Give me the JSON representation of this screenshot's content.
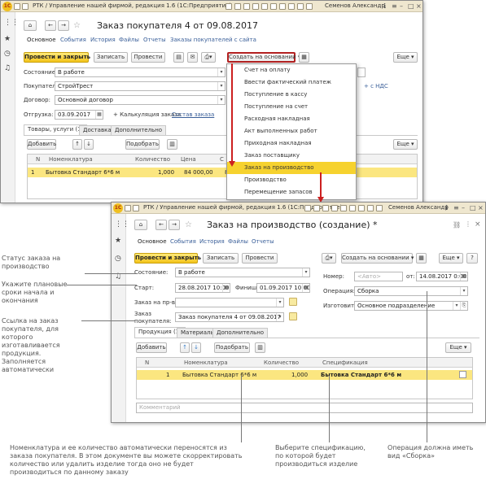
{
  "win1": {
    "title_bar": "РТК / Управление нашей фирмой, редакция 1.6  (1С:Предприятие)",
    "user": "Семенов Александр",
    "doc_title": "Заказ покупателя 4  от 09.08.2017",
    "nav_tabs": [
      "Основное",
      "События",
      "История",
      "Файлы",
      "Отчеты",
      "Заказы покупателей с сайта"
    ],
    "toolbar": {
      "post_close": "Провести и закрыть",
      "save": "Записать",
      "post": "Провести",
      "create_based": "Создать на основании",
      "more": "Еще"
    },
    "fields": {
      "state_label": "Состояние:",
      "state_value": "В работе",
      "buyer_label": "Покупатель:",
      "buyer_value": "СтройТрест",
      "contract_label": "Договор:",
      "contract_value": "Основной договор",
      "ship_label": "Отгрузка:",
      "ship_value": "03.09.2017",
      "calc_link": "+ Калькуляция заказа",
      "order_composition": "Состав заказа",
      "vat_link": "+ с НДС"
    },
    "tabs": [
      "Товары, услуги (1)",
      "Доставка",
      "Дополнительно"
    ],
    "table_toolbar": {
      "add": "Добавить",
      "pick": "Подобрать",
      "more": "Еще"
    },
    "columns": [
      "N",
      "Номенклатура",
      "Количество",
      "Цена",
      "С"
    ],
    "rows": [
      {
        "n": "1",
        "item": "Бытовка Стандарт 6*6 м",
        "qty": "1,000",
        "price": "84 000,00",
        "sum": "8"
      }
    ],
    "menu": [
      "Счет на оплату",
      "Ввести фактический платеж",
      "Поступление в кассу",
      "Поступление на счет",
      "Расходная накладная",
      "Акт выполненных работ",
      "Приходная накладная",
      "Заказ поставщику",
      "Заказ на производство",
      "Производство",
      "Перемещение запасов"
    ],
    "menu_selected": "Заказ на производство"
  },
  "win2": {
    "title_bar": "РТК / Управление нашей фирмой, редакция 1.6  (1С:Предприятие)",
    "user": "Семенов Александр",
    "doc_title": "Заказ на производство (создание) *",
    "nav_tabs": [
      "Основное",
      "События",
      "История",
      "Файлы",
      "Отчеты"
    ],
    "toolbar": {
      "post_close": "Провести и закрыть",
      "save": "Записать",
      "post": "Провести",
      "create_based": "Создать на основании",
      "more": "Еще",
      "help": "?"
    },
    "fields": {
      "state_label": "Состояние:",
      "state_value": "В работе",
      "start_label": "Старт:",
      "start_value": "28.08.2017 10:00",
      "finish_label": "Финиш:",
      "finish_value": "01.09.2017 10:00",
      "pp_label": "Заказ на пр-во:",
      "buyer_order_label": "Заказ покупателя:",
      "buyer_order_value": "Заказ покупателя 4  от 09.08.2017",
      "number_label": "Номер:",
      "number_placeholder": "<Авто>",
      "from_label": "от:",
      "from_value": "14.08.2017  0:00:00",
      "op_label": "Операция:",
      "op_value": "Сборка",
      "maker_label": "Изготовитель:",
      "maker_value": "Основное подразделение"
    },
    "tabs": [
      "Продукция (1)",
      "Материалы",
      "Дополнительно"
    ],
    "table_toolbar": {
      "add": "Добавить",
      "pick": "Подобрать",
      "more": "Еще"
    },
    "columns": [
      "N",
      "Номенклатура",
      "Количество",
      "Спецификация"
    ],
    "rows": [
      {
        "n": "1",
        "item": "Бытовка Стандарт 6*6 м",
        "qty": "1,000",
        "spec": "Бытовка Стандарт 6*6 м"
      }
    ],
    "comment_placeholder": "Комментарий"
  },
  "annotations": {
    "a1": "Статус заказа на производство",
    "a2": "Укажите плановые сроки начала и окончания",
    "a3": "Ссылка на заказ покупателя, для которого изготавливается продукция. Заполняется автоматически",
    "b1": "Номенклатура и ее количество автоматически переносятся из заказа покупателя. В этом документе вы можете скорректировать количество или удалить изделие тогда оно не будет производиться по данному заказу",
    "b2": "Выберите спецификацию, по которой будет производиться изделие",
    "b3": "Операция должна иметь вид «Сборка»"
  },
  "colors": {
    "accent_yellow": "#f6d22e",
    "arrow_red": "#cc2020",
    "link_blue": "#3a5f99"
  }
}
